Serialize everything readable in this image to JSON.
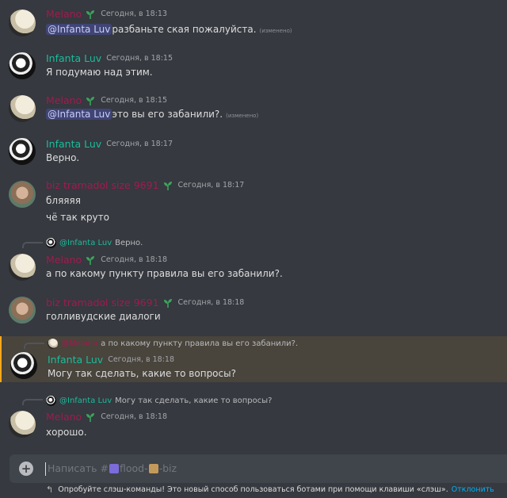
{
  "messages": [
    {
      "user": "Melano",
      "time": "Сегодня, в 18:13",
      "mention": "@Infanta Luv",
      "text": "разбаньте ская пожалуйста.",
      "edited": "(изменено)"
    },
    {
      "user": "Infanta Luv",
      "time": "Сегодня, в 18:15",
      "text": "Я подумаю над этим."
    },
    {
      "user": "Melano",
      "time": "Сегодня, в 18:15",
      "mention": "@Infanta Luv",
      "text": "это вы его забанили?.",
      "edited": "(изменено)"
    },
    {
      "user": "Infanta Luv",
      "time": "Сегодня, в 18:17",
      "text": "Верно."
    },
    {
      "user": "biz tramadol size 9691",
      "time": "Сегодня, в 18:17",
      "text": "бляяяя",
      "text2": "чё так круто"
    },
    {
      "reply_name": "@Infanta Luv",
      "reply_text": "Верно.",
      "user": "Melano",
      "time": "Сегодня, в 18:18",
      "text": "а по какому пункту правила вы его забанили?."
    },
    {
      "user": "biz tramadol size 9691",
      "time": "Сегодня, в 18:18",
      "text": "голливудские диалоги"
    },
    {
      "reply_name": "@Melano",
      "reply_text": "а по какому пункту правила вы его забанили?.",
      "user": "Infanta Luv",
      "time": "Сегодня, в 18:18",
      "text": "Могу так сделать, какие то вопросы?"
    },
    {
      "reply_name": "@Infanta Luv",
      "reply_text": "Могу так сделать, какие то вопросы?",
      "user": "Melano",
      "time": "Сегодня, в 18:18",
      "text": "хорошо."
    }
  ],
  "composer": {
    "add_icon": "plus-circle-icon",
    "placeholder_prefix": "Написать #",
    "placeholder_channel": "flood-",
    "placeholder_suffix": "-biz"
  },
  "hint": {
    "icon": "corner-up-arrow-icon",
    "text": "Опробуйте слэш-команды! Это новый способ пользоваться ботами при помощи клавиши «слэш».",
    "dismiss": "Отклонить"
  },
  "colors": {
    "background": "#36393f",
    "melano": "#a11a4f",
    "luv": "#1abc9c",
    "link": "#00aff4",
    "highlight": "#49443c"
  }
}
